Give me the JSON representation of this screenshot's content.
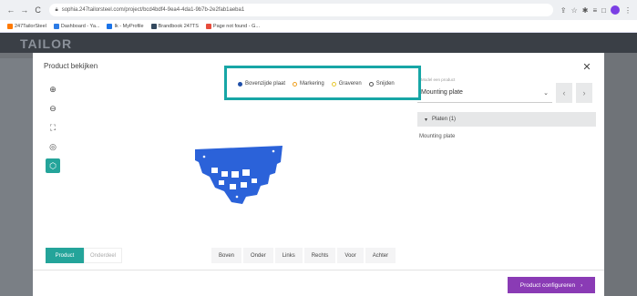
{
  "browser": {
    "url": "sophia.247tailorsteel.com/project/bcd4bdf4-9ea4-4da1-9b7b-2e2fab1aeba1",
    "bookmarks": [
      {
        "label": "247TailorSteel",
        "color": "#ff7a00"
      },
      {
        "label": "Dashboard - Ya...",
        "color": "#2c7be5"
      },
      {
        "label": "Ik - MyProfile",
        "color": "#1a73e8"
      },
      {
        "label": "Brandbook 247TS",
        "color": "#34495e"
      },
      {
        "label": "Page not found - G...",
        "color": "#e74c3c"
      }
    ]
  },
  "background_app": {
    "logo": "TAILOR"
  },
  "modal": {
    "title": "Product bekijken",
    "close_label": "✕",
    "tools": [
      {
        "name": "zoom-in-icon",
        "glyph": "⊕"
      },
      {
        "name": "zoom-out-icon",
        "glyph": "⊖"
      },
      {
        "name": "fit-view-icon",
        "glyph": "⛶"
      },
      {
        "name": "layers-icon",
        "glyph": "◎"
      },
      {
        "name": "cube-icon",
        "glyph": "⬡"
      }
    ],
    "legend": [
      {
        "label": "Bovenzijde plaat",
        "color": "#1f4fa8",
        "style": "filled"
      },
      {
        "label": "Markering",
        "color": "#f0a020",
        "style": "ring"
      },
      {
        "label": "Graveren",
        "color": "#e8c830",
        "style": "ring"
      },
      {
        "label": "Snijden",
        "color": "#555555",
        "style": "ring"
      }
    ],
    "highlight_color": "#17a6a6",
    "part_color": "#2b62d9",
    "select": {
      "label": "Model een product",
      "value": "Mounting plate"
    },
    "plates_header": "Platen (1)",
    "plate_item": "Mounting plate",
    "tabs": {
      "product": "Product",
      "onderdeel": "Onderdeel"
    },
    "views": [
      "Boven",
      "Onder",
      "Links",
      "Rechts",
      "Voor",
      "Achter"
    ],
    "configure_label": "Product configureren",
    "accent_teal": "#24a49a",
    "accent_purple": "#8a3bb5"
  }
}
